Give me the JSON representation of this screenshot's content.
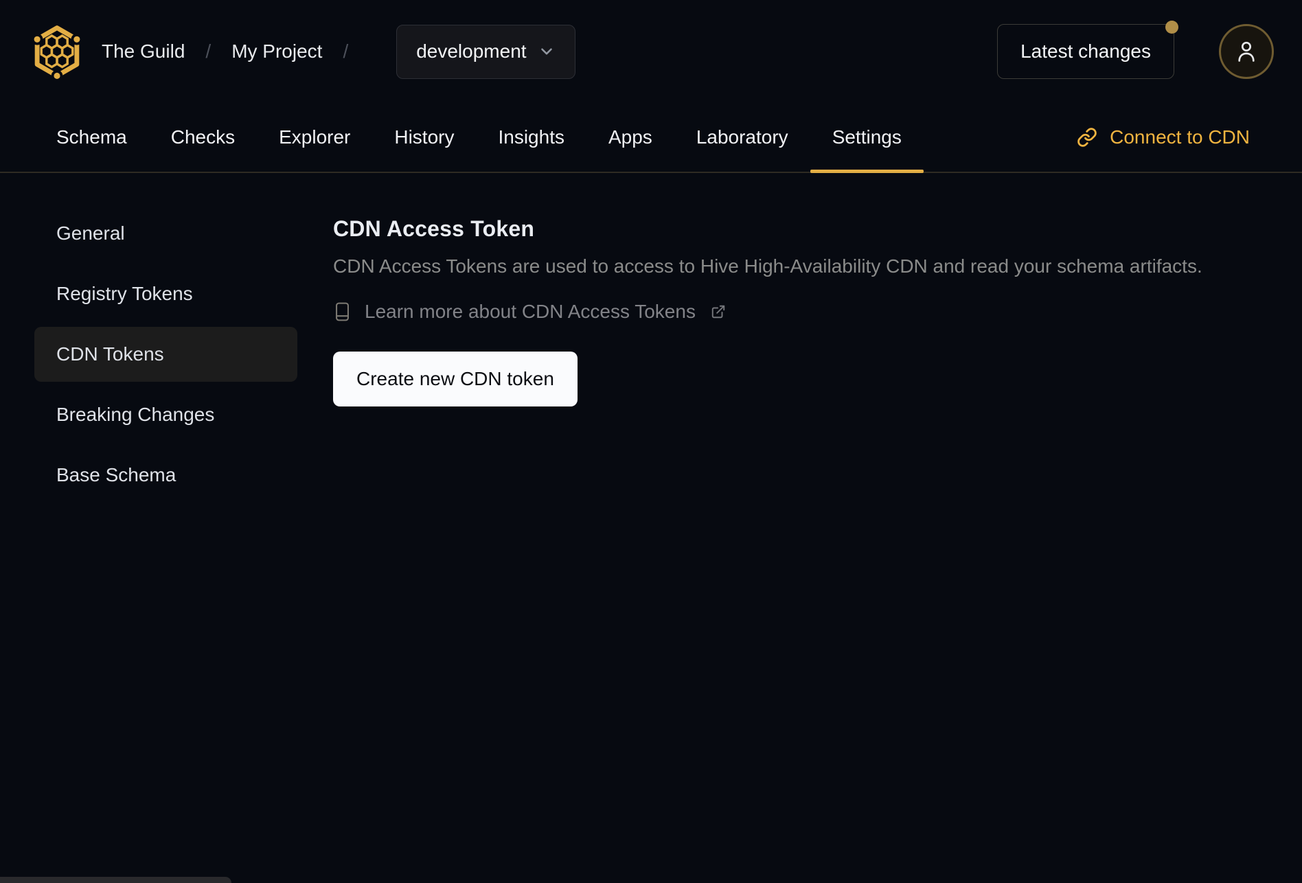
{
  "header": {
    "org_name": "The Guild",
    "project_name": "My Project",
    "separator": "/",
    "environment_select": {
      "value": "development"
    },
    "latest_changes_label": "Latest changes"
  },
  "tabs": {
    "items": [
      {
        "label": "Schema",
        "active": false
      },
      {
        "label": "Checks",
        "active": false
      },
      {
        "label": "Explorer",
        "active": false
      },
      {
        "label": "History",
        "active": false
      },
      {
        "label": "Insights",
        "active": false
      },
      {
        "label": "Apps",
        "active": false
      },
      {
        "label": "Laboratory",
        "active": false
      },
      {
        "label": "Settings",
        "active": true
      }
    ],
    "connect_cdn_label": "Connect to CDN"
  },
  "sidebar": {
    "items": [
      {
        "label": "General",
        "active": false
      },
      {
        "label": "Registry Tokens",
        "active": false
      },
      {
        "label": "CDN Tokens",
        "active": true
      },
      {
        "label": "Breaking Changes",
        "active": false
      },
      {
        "label": "Base Schema",
        "active": false
      }
    ]
  },
  "main": {
    "title": "CDN Access Token",
    "description": "CDN Access Tokens are used to access to Hive High-Availability CDN and read your schema artifacts.",
    "learn_more_label": "Learn more about CDN Access Tokens",
    "create_button_label": "Create new CDN token"
  },
  "icons": {
    "hive-logo-icon": "gold hexagon with honeycomb cells and corner dots",
    "chevron-down-icon": "v",
    "link-icon": "chain link",
    "user-icon": "person silhouette outline",
    "book-icon": "closed book outline",
    "external-link-icon": "box with north-east arrow"
  },
  "colors": {
    "page_bg": "#070a11",
    "accent_gold": "#e3ae45",
    "connect_gold": "#f0b440",
    "notification_dot": "#b08e48",
    "avatar_ring": "#6f5c31",
    "active_sidebar_bg": "#1c1c1c",
    "create_button_bg": "#fafbfd",
    "tabbar_border": "#2e2b23"
  }
}
